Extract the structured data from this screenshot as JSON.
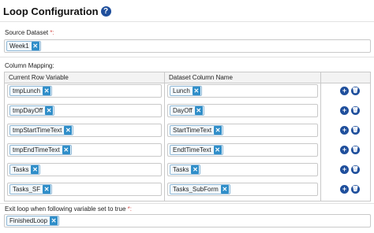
{
  "header": {
    "title": "Loop Configuration",
    "help_icon": "question-circle-icon"
  },
  "source_dataset": {
    "label": "Source Dataset",
    "required_mark": "*:",
    "value": "Week1"
  },
  "column_mapping": {
    "label": "Column Mapping:",
    "col_current": "Current Row Variable",
    "col_dataset": "Dataset Column Name",
    "rows": [
      {
        "variable": "tmpLunch",
        "column": "Lunch"
      },
      {
        "variable": "tmpDayOff",
        "column": "DayOff"
      },
      {
        "variable": "tmpStartTimeText",
        "column": "StartTimeText"
      },
      {
        "variable": "tmpEndTimeText",
        "column": "EndtTimeText"
      },
      {
        "variable": "Tasks",
        "column": "Tasks"
      },
      {
        "variable": "Tasks_SF",
        "column": "Tasks_SubForm"
      }
    ]
  },
  "exit_loop": {
    "label": "Exit loop when following variable set to true",
    "required_mark": "*:",
    "value": "FinishedLoop"
  },
  "colors": {
    "accent": "#1f4f9c",
    "tag_remove": "#2f8ec9",
    "required": "#d9534f"
  },
  "icons": {
    "tag_remove": "x-icon",
    "add_row": "plus-circle-icon",
    "delete_row": "trash-icon"
  }
}
